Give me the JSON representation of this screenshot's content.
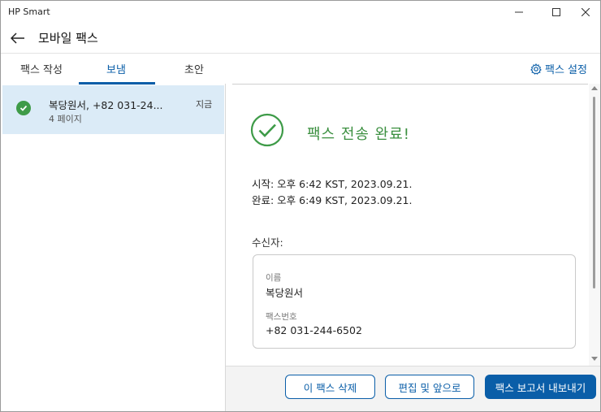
{
  "app": {
    "title": "HP Smart"
  },
  "header": {
    "title": "모바일 팩스"
  },
  "tabs": [
    {
      "label": "팩스 작성"
    },
    {
      "label": "보냄"
    },
    {
      "label": "초안"
    }
  ],
  "settings": {
    "label": "팩스 설정"
  },
  "list": {
    "items": [
      {
        "name": "복당원서, +82 031-24...",
        "pages": "4 페이지",
        "time": "지금"
      }
    ]
  },
  "detail": {
    "status_title": "팩스 전송 완료!",
    "start": "시작: 오후 6:42 KST, 2023.09.21.",
    "end": "완료: 오후 6:49 KST, 2023.09.21.",
    "recipient_label": "수신자:",
    "recipient": {
      "name_label": "이름",
      "name": "복당원서",
      "fax_label": "팩스번호",
      "fax": "+82 031-244-6502"
    }
  },
  "footer": {
    "delete": "이 팩스 삭제",
    "edit_resend": "편집 및 앞으로",
    "export_report": "팩스 보고서 내보내기"
  },
  "colors": {
    "accent": "#0a5ea8",
    "success": "#3e9b48",
    "selected_bg": "#dbebf7"
  }
}
